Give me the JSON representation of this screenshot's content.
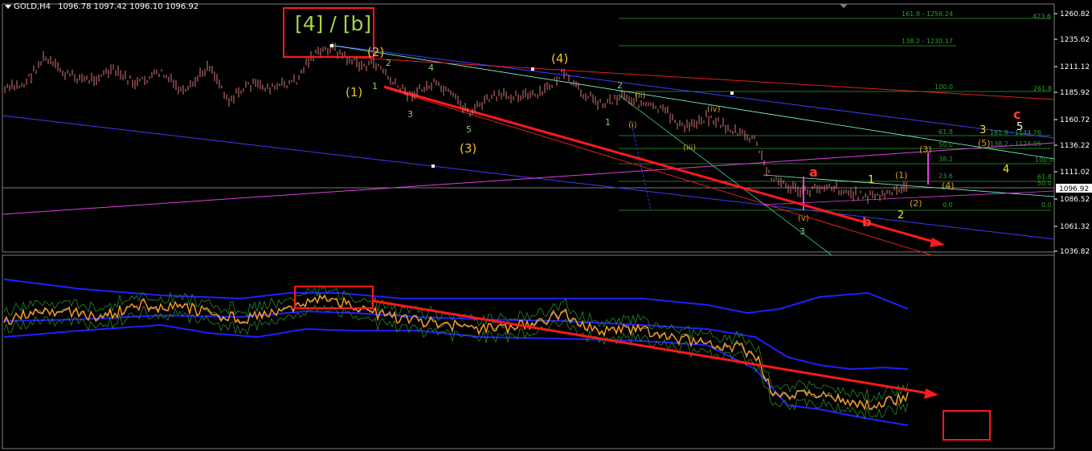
{
  "header": {
    "symbol": "GOLD,H4",
    "ohlc": "1096.78 1097.42 1096.10 1096.92"
  },
  "price_axis": {
    "ticks": [
      "1260.82",
      "1235.62",
      "1211.12",
      "1185.92",
      "1160.72",
      "1136.22",
      "1111.02",
      "1086.52",
      "1061.32",
      "1036.82"
    ],
    "current": "1096.92"
  },
  "annotations": {
    "wave_4b": "[4] / [b]",
    "w2": "(2)",
    "w1": "(1)",
    "w3": "(3)",
    "w4": "(4)",
    "sub": [
      "1",
      "2",
      "3",
      "4",
      "5"
    ],
    "rom": [
      "(i)",
      "(ii)",
      "(iii)",
      "(iv)",
      "(v)"
    ],
    "a": "a",
    "b": "b",
    "c": "c",
    "n1": "1",
    "n2": "2",
    "n3": "3",
    "n4": "4",
    "n5": "5",
    "c3": "(3)",
    "c1": "(1)",
    "c2": "(2)",
    "c4": "(4)",
    "c5": "(5)"
  },
  "fib_labels": {
    "f1618": "161.8 - 1256.24",
    "f1382": "138.2 - 1230.17",
    "f1000": "100.0",
    "f4236": "423.6",
    "f2618": "261.8",
    "f618": "61.8",
    "f500": "50.0",
    "f382": "38.2",
    "f236": "23.6",
    "f00": "0.0",
    "r1618": "161.8 - 1144.76",
    "r1382": "138.2 - 1124.95",
    "r1000": "100.0",
    "r618": "61.8",
    "r500": "50.0",
    "r00": "0.0"
  },
  "colors": {
    "candle": "#d97a7a",
    "grid_label": "#c0c0c0",
    "fib": "#2a8a2a",
    "trend_red": "#ff1a1a",
    "trend_blue": "#3a3aff",
    "trend_magenta": "#e040e0",
    "wave_yellow": "#f0c020",
    "osc_orange": "#ff9a20"
  }
}
